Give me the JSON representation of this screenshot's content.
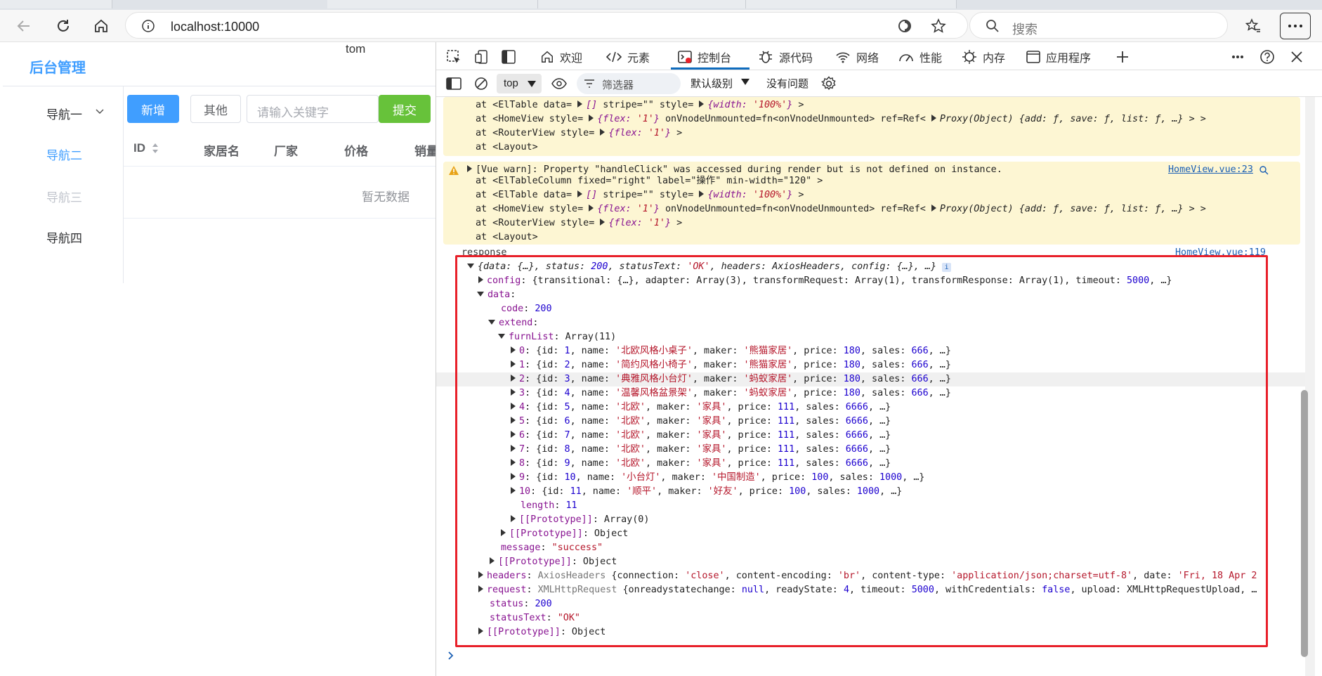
{
  "browser": {
    "url": "localhost:10000",
    "search_placeholder": "搜索"
  },
  "app": {
    "brand": "后台管理",
    "user": "tom",
    "nav": [
      "导航一",
      "导航二",
      "导航三",
      "导航四"
    ],
    "buttons": {
      "add": "新增",
      "other": "其他",
      "submit": "提交"
    },
    "keyword_placeholder": "请输入关键字",
    "table_headers": [
      "ID",
      "家居名",
      "厂家",
      "价格",
      "销量"
    ],
    "empty_text": "暂无数据",
    "colors": {
      "primary": "#409eff",
      "success": "#67c23a"
    }
  },
  "devtools": {
    "tabs": [
      "欢迎",
      "元素",
      "控制台",
      "源代码",
      "网络",
      "性能",
      "内存",
      "应用程序"
    ],
    "active_tab": "控制台",
    "context": "top",
    "filter_placeholder": "筛选器",
    "level": "默认级别",
    "issues": "没有问题",
    "warn1_lines": [
      "at <ElTable data= ▶[] stripe=\"\" style= ▶{width: '100%'} >",
      "at <HomeView style= ▶{flex: '1'} onVnodeUnmounted=fn<onVnodeUnmounted> ref=Ref< ▶Proxy(Object) {add: ƒ, save: ƒ, list: ƒ, …} > >",
      "at <RouterView style= ▶{flex: '1'} >",
      "at <Layout>"
    ],
    "warn2": {
      "message": "▶[Vue warn]: Property \"handleClick\" was accessed during render but is not defined on instance.",
      "source": "HomeView.vue:23",
      "lines": [
        "at <ElTableColumn fixed=\"right\" label=\"操作\" min-width=\"120\" >",
        "at <ElTable data= ▶[] stripe=\"\" style= ▶{width: '100%'} >",
        "at <HomeView style= ▶{flex: '1'} onVnodeUnmounted=fn<onVnodeUnmounted> ref=Ref< ▶Proxy(Object) {add: ƒ, save: ƒ, list: ƒ, …} > >",
        "at <RouterView style= ▶{flex: '1'} >",
        "at <Layout>"
      ]
    },
    "log_label": "response",
    "log_source": "HomeView.vue:119",
    "furn": [
      {
        "idx": "0",
        "id": "1",
        "name": "北欧风格小桌子",
        "maker": "熊猫家居",
        "price": "180",
        "sales": "666"
      },
      {
        "idx": "1",
        "id": "2",
        "name": "简约风格小椅子",
        "maker": "熊猫家居",
        "price": "180",
        "sales": "666"
      },
      {
        "idx": "2",
        "id": "3",
        "name": "典雅风格小台灯",
        "maker": "蚂蚁家居",
        "price": "180",
        "sales": "666"
      },
      {
        "idx": "3",
        "id": "4",
        "name": "温馨风格盆景架",
        "maker": "蚂蚁家居",
        "price": "180",
        "sales": "666"
      },
      {
        "idx": "4",
        "id": "5",
        "name": "北欧",
        "maker": "家具",
        "price": "111",
        "sales": "6666"
      },
      {
        "idx": "5",
        "id": "6",
        "name": "北欧",
        "maker": "家具",
        "price": "111",
        "sales": "6666"
      },
      {
        "idx": "6",
        "id": "7",
        "name": "北欧",
        "maker": "家具",
        "price": "111",
        "sales": "6666"
      },
      {
        "idx": "7",
        "id": "8",
        "name": "北欧",
        "maker": "家具",
        "price": "111",
        "sales": "6666"
      },
      {
        "idx": "8",
        "id": "9",
        "name": "北欧",
        "maker": "家具",
        "price": "111",
        "sales": "6666"
      },
      {
        "idx": "9",
        "id": "10",
        "name": "小台灯",
        "maker": "中国制造",
        "price": "100",
        "sales": "1000"
      },
      {
        "idx": "10",
        "id": "11",
        "name": "顺平",
        "maker": "好友",
        "price": "100",
        "sales": "1000"
      }
    ]
  }
}
